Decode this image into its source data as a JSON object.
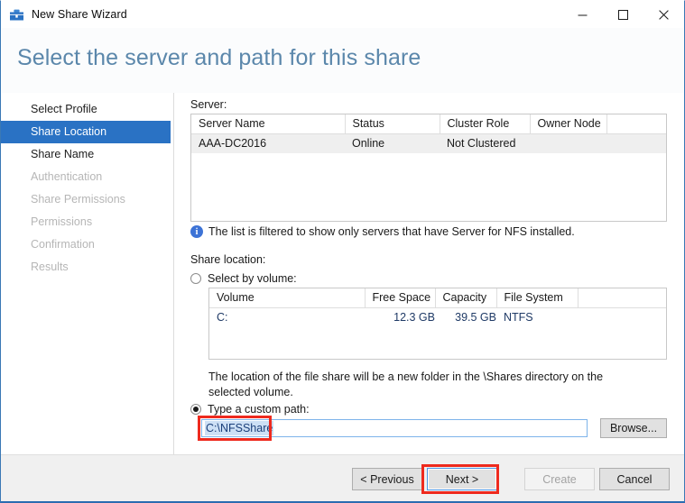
{
  "window": {
    "title": "New Share Wizard",
    "icon": "share-wizard-icon",
    "minimize_label": "—",
    "maximize_label": "□",
    "close_label": "✕"
  },
  "header": {
    "heading": "Select the server and path for this share"
  },
  "nav": {
    "items": [
      {
        "label": "Select Profile",
        "state": "done"
      },
      {
        "label": "Share Location",
        "state": "active"
      },
      {
        "label": "Share Name",
        "state": "done"
      },
      {
        "label": "Authentication",
        "state": "disabled"
      },
      {
        "label": "Share Permissions",
        "state": "disabled"
      },
      {
        "label": "Permissions",
        "state": "disabled"
      },
      {
        "label": "Confirmation",
        "state": "disabled"
      },
      {
        "label": "Results",
        "state": "disabled"
      }
    ]
  },
  "content": {
    "server_label": "Server:",
    "server_table": {
      "columns": [
        "Server Name",
        "Status",
        "Cluster Role",
        "Owner Node",
        ""
      ],
      "rows": [
        [
          "AAA-DC2016",
          "Online",
          "Not Clustered",
          "",
          ""
        ]
      ]
    },
    "info": {
      "icon": "info-icon",
      "glyph": "i",
      "text": "The list is filtered to show only servers that have Server for NFS installed."
    },
    "share_location_label": "Share location:",
    "select_by_volume": {
      "label": "Select by volume:",
      "checked": false
    },
    "volume_table": {
      "columns": [
        "Volume",
        "Free Space",
        "Capacity",
        "File System",
        ""
      ],
      "rows": [
        [
          "C:",
          "12.3 GB",
          "39.5 GB",
          "NTFS",
          ""
        ]
      ]
    },
    "hint": "The location of the file share will be a new folder in the \\Shares directory on the selected volume.",
    "custom_path": {
      "label": "Type a custom path:",
      "checked": true,
      "value": "C:\\NFSShare",
      "placeholder": "",
      "browse_label": "Browse..."
    }
  },
  "footer": {
    "previous_label": "< Previous",
    "next_label": "Next >",
    "create_label": "Create",
    "cancel_label": "Cancel"
  },
  "annotations": {
    "highlight_color": "#ee2a1e",
    "accent_color": "#2a72c4",
    "heading_color": "#5b87ab"
  }
}
